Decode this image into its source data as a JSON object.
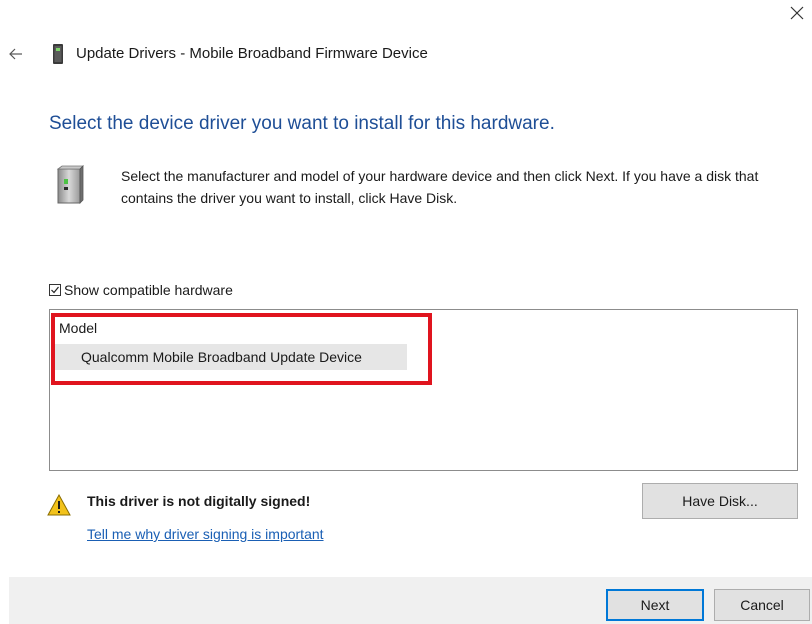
{
  "window": {
    "title": "Update Drivers - Mobile Broadband Firmware Device",
    "close_icon": "close-icon",
    "back_icon": "back-arrow-icon"
  },
  "main": {
    "heading": "Select the device driver you want to install for this hardware.",
    "instructions": "Select the manufacturer and model of your hardware device and then click Next. If you have a disk that contains the driver you want to install, click Have Disk.",
    "show_compatible": {
      "label": "Show compatible hardware",
      "checked": true
    },
    "model_list": {
      "header": "Model",
      "items": [
        "Qualcomm Mobile Broadband Update Device"
      ]
    },
    "warning": {
      "text": "This driver is not digitally signed!",
      "link": "Tell me why driver signing is important"
    },
    "have_disk_label": "Have Disk..."
  },
  "footer": {
    "next_label": "Next",
    "cancel_label": "Cancel"
  },
  "colors": {
    "heading": "#1e4e96",
    "link": "#1a5fb4",
    "highlight": "#e0141e",
    "default_button_border": "#0078d7"
  }
}
